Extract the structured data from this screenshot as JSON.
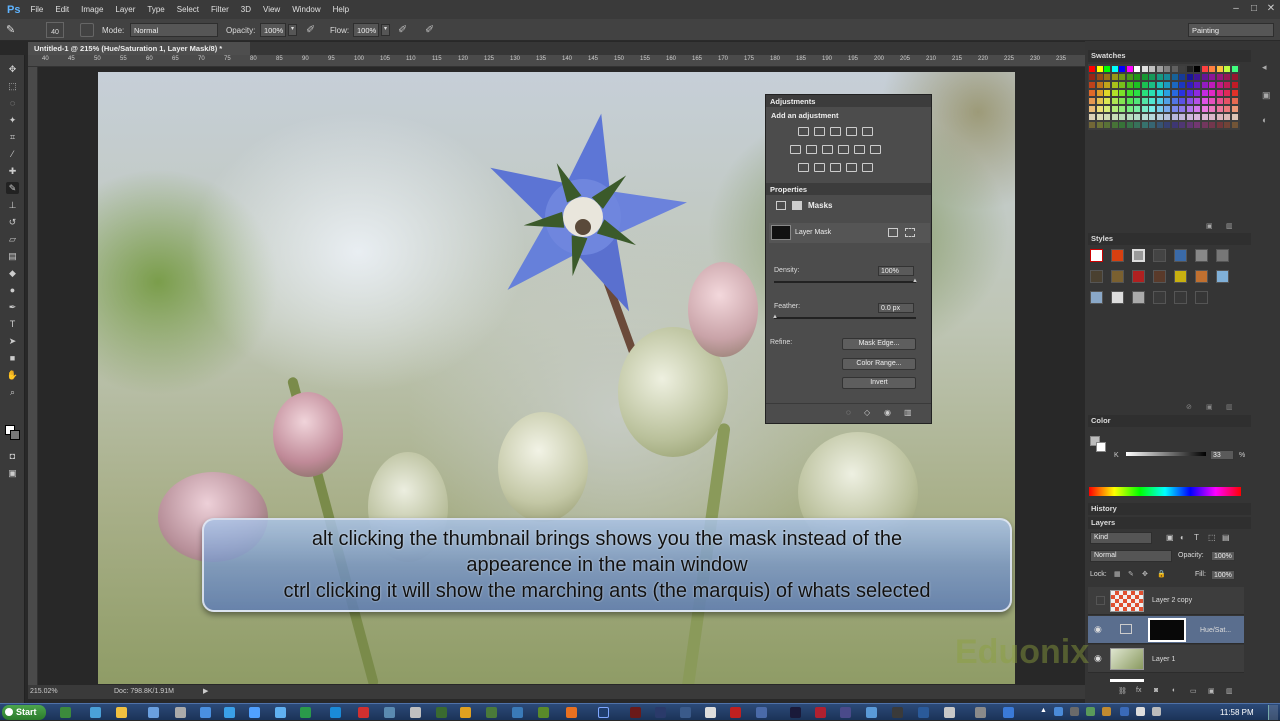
{
  "app": {
    "logo": "Ps"
  },
  "menu": [
    "File",
    "Edit",
    "Image",
    "Layer",
    "Type",
    "Select",
    "Filter",
    "3D",
    "View",
    "Window",
    "Help"
  ],
  "options_bar": {
    "brush_size": "40",
    "mode_label": "Mode:",
    "mode_value": "Normal",
    "opacity_label": "Opacity:",
    "opacity_value": "100%",
    "flow_label": "Flow:",
    "flow_value": "100%",
    "workspace": "Painting"
  },
  "document": {
    "tab_title": "Untitled-1 @ 215% (Hue/Saturation 1, Layer Mask/8) *",
    "zoom": "215.02%",
    "doc_info": "Doc: 798.8K/1.91M"
  },
  "ruler_ticks": [
    "40",
    "45",
    "50",
    "55",
    "60",
    "65",
    "70",
    "75",
    "80",
    "85",
    "90",
    "95",
    "100",
    "105",
    "110",
    "115",
    "120",
    "125",
    "130",
    "135",
    "140",
    "145",
    "150",
    "155",
    "160",
    "165",
    "170",
    "175",
    "180",
    "185",
    "190",
    "195",
    "200",
    "205",
    "210",
    "215",
    "220",
    "225",
    "230",
    "235",
    "240"
  ],
  "adjustments": {
    "title": "Adjustments",
    "add_label": "Add an adjustment"
  },
  "properties": {
    "title": "Properties",
    "section": "Masks",
    "mask_label": "Layer Mask",
    "density_label": "Density:",
    "density_value": "100%",
    "feather_label": "Feather:",
    "feather_value": "0.0 px",
    "refine_label": "Refine:",
    "mask_edge_button": "Mask Edge...",
    "color_range_button": "Color Range...",
    "invert_button": "Invert"
  },
  "panels": {
    "swatches": "Swatches",
    "styles": "Styles",
    "color": "Color",
    "color_k_label": "K",
    "color_k_value": "33",
    "color_k_unit": "%",
    "history": "History",
    "layers": "Layers"
  },
  "layers_panel": {
    "filter_kind": "Kind",
    "blend_mode": "Normal",
    "opacity_label": "Opacity:",
    "opacity_value": "100%",
    "lock_label": "Lock:",
    "fill_label": "Fill:",
    "fill_value": "100%",
    "layers": [
      {
        "name": "Layer 2 copy"
      },
      {
        "name": "Hue/Sat..."
      },
      {
        "name": "Layer 1"
      }
    ]
  },
  "caption": {
    "line1": "alt clicking the thumbnail brings shows you the mask instead of the",
    "line2": "appearence in the main window",
    "line3": "ctrl clicking it will show the marching ants (the marquis) of whats selected"
  },
  "watermark": "Eduonix",
  "taskbar": {
    "start_label": "Start",
    "clock": "11:58 PM"
  },
  "colors": {
    "ps_blue": "#5fb4ff",
    "panel_bg": "#353535",
    "caption_bg": "#7d9bd0"
  }
}
